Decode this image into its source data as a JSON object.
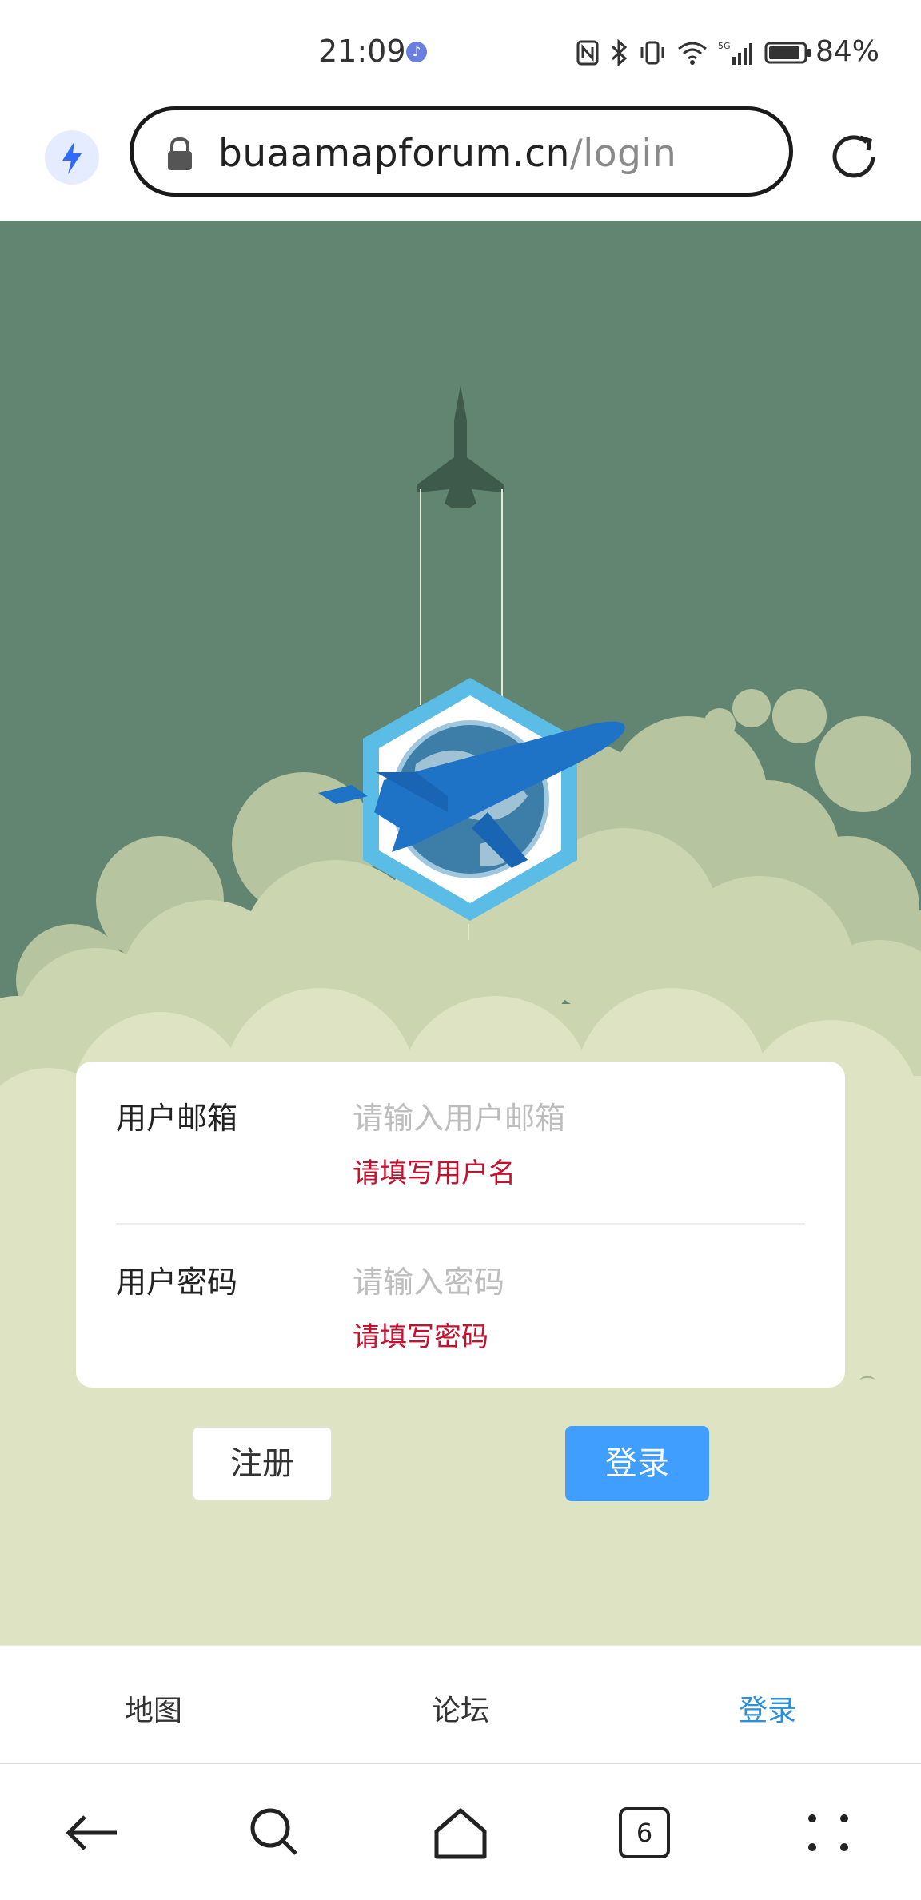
{
  "status_bar": {
    "time": "21:09",
    "battery": "84%"
  },
  "browser": {
    "url_domain": "buaamapforum.cn",
    "url_path": "/login"
  },
  "form": {
    "email_label": "用户邮箱",
    "email_placeholder": "请输入用户邮箱",
    "email_error": "请填写用户名",
    "password_label": "用户密码",
    "password_placeholder": "请输入密码",
    "password_error": "请填写密码"
  },
  "buttons": {
    "register": "注册",
    "login": "登录"
  },
  "tabs": [
    {
      "label": "地图"
    },
    {
      "label": "论坛"
    },
    {
      "label": "登录"
    }
  ],
  "nav": {
    "tab_count": "6"
  },
  "colors": {
    "background": "#628571",
    "accent": "#409eff",
    "error": "#c8102e",
    "active_tab": "#2b8fd9"
  }
}
